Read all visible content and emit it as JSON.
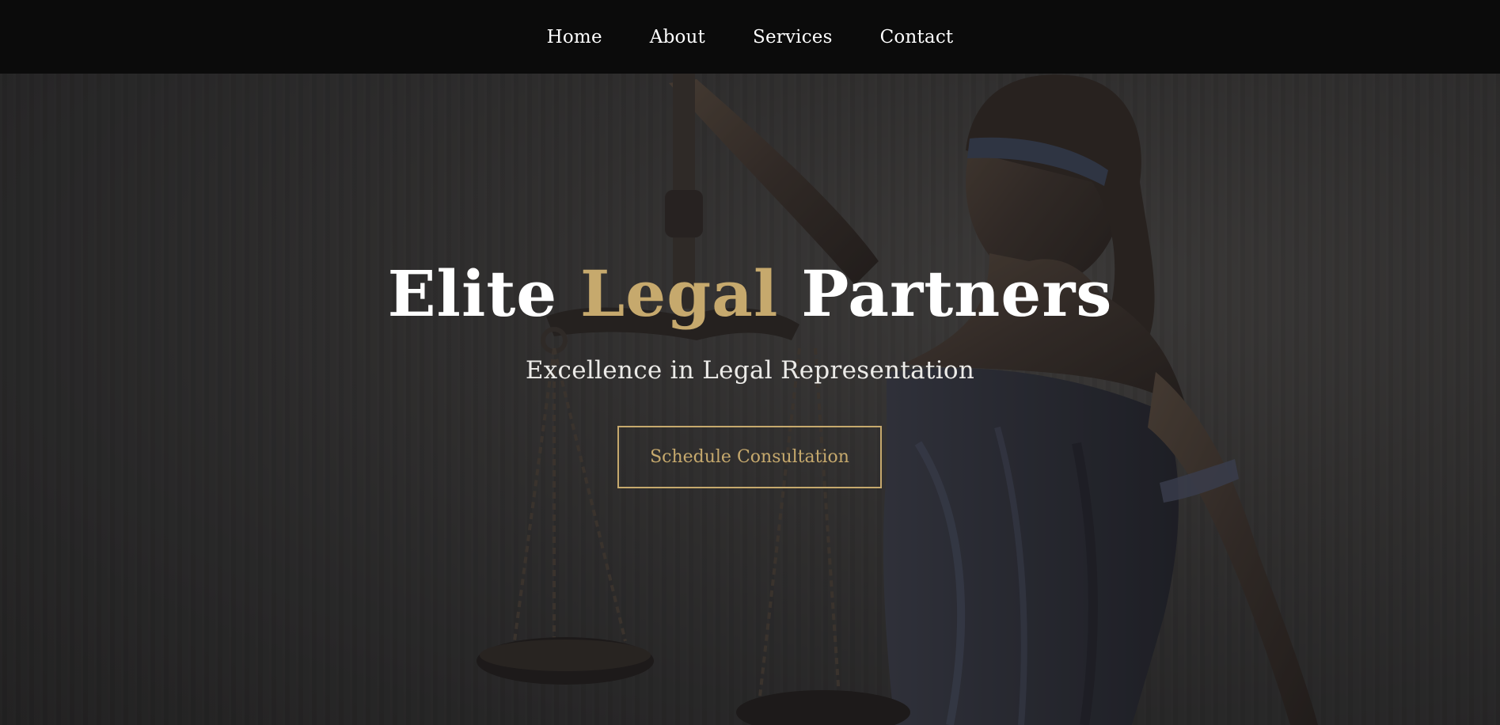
{
  "nav": {
    "items": [
      {
        "label": "Home"
      },
      {
        "label": "About"
      },
      {
        "label": "Services"
      },
      {
        "label": "Contact"
      }
    ]
  },
  "hero": {
    "title_part1": "Elite",
    "title_accent": "Legal",
    "title_part2": "Partners",
    "subtitle": "Excellence in Legal Representation",
    "cta_label": "Schedule Consultation",
    "background_image": "lady-justice-statue-icon"
  },
  "colors": {
    "accent": "#c6a96d",
    "nav_background": "#0b0b0b",
    "text": "#ffffff"
  }
}
